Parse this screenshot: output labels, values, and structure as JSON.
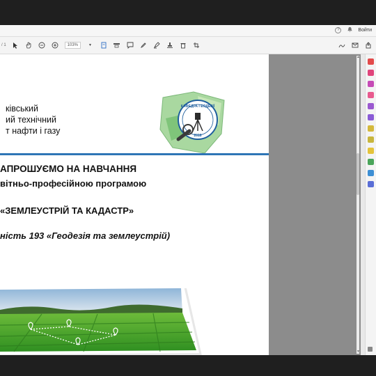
{
  "app": {
    "signin_label": "Войти"
  },
  "toolbar": {
    "page_indicator": "/ 1",
    "zoom_level": "103%"
  },
  "document": {
    "institution_lines": [
      "ківський",
      "ий технічний",
      "т нафти і газу"
    ],
    "heading_invite": "АПРОШУЄМО НА НАВЧАННЯ",
    "heading_program": "вітньо-професійною програмою",
    "heading_program_name": "«ЗЕМЛЕУСТРІЙ ТА КАДАСТР»",
    "heading_specialty": "ність 193 «Геодезія та землеустрій)",
    "logo_text_top": "КАФЕДРА ГЕОДЕЗІЇ ТА ЗЕМЛЕУСТРОЮ",
    "logo_text_year": "2018",
    "accent_color": "#2e75b6"
  },
  "icons": {
    "title_bar": [
      "help-icon",
      "bell-icon"
    ],
    "toolbar": [
      "select-cursor-icon",
      "hand-icon",
      "zoom-out-icon",
      "zoom-in-icon",
      "page-fit-icon",
      "comment-icon",
      "pen-icon",
      "highlight-icon",
      "stamp-icon",
      "delete-icon",
      "share-icon"
    ],
    "right_rail": [
      "export-pdf-icon",
      "create-pdf-icon",
      "edit-pdf-icon",
      "combine-icon",
      "organize-icon",
      "fill-sign-icon",
      "scan-icon",
      "protect-icon",
      "comment-tool-icon",
      "compare-icon",
      "redact-icon",
      "more-tools-icon"
    ]
  }
}
